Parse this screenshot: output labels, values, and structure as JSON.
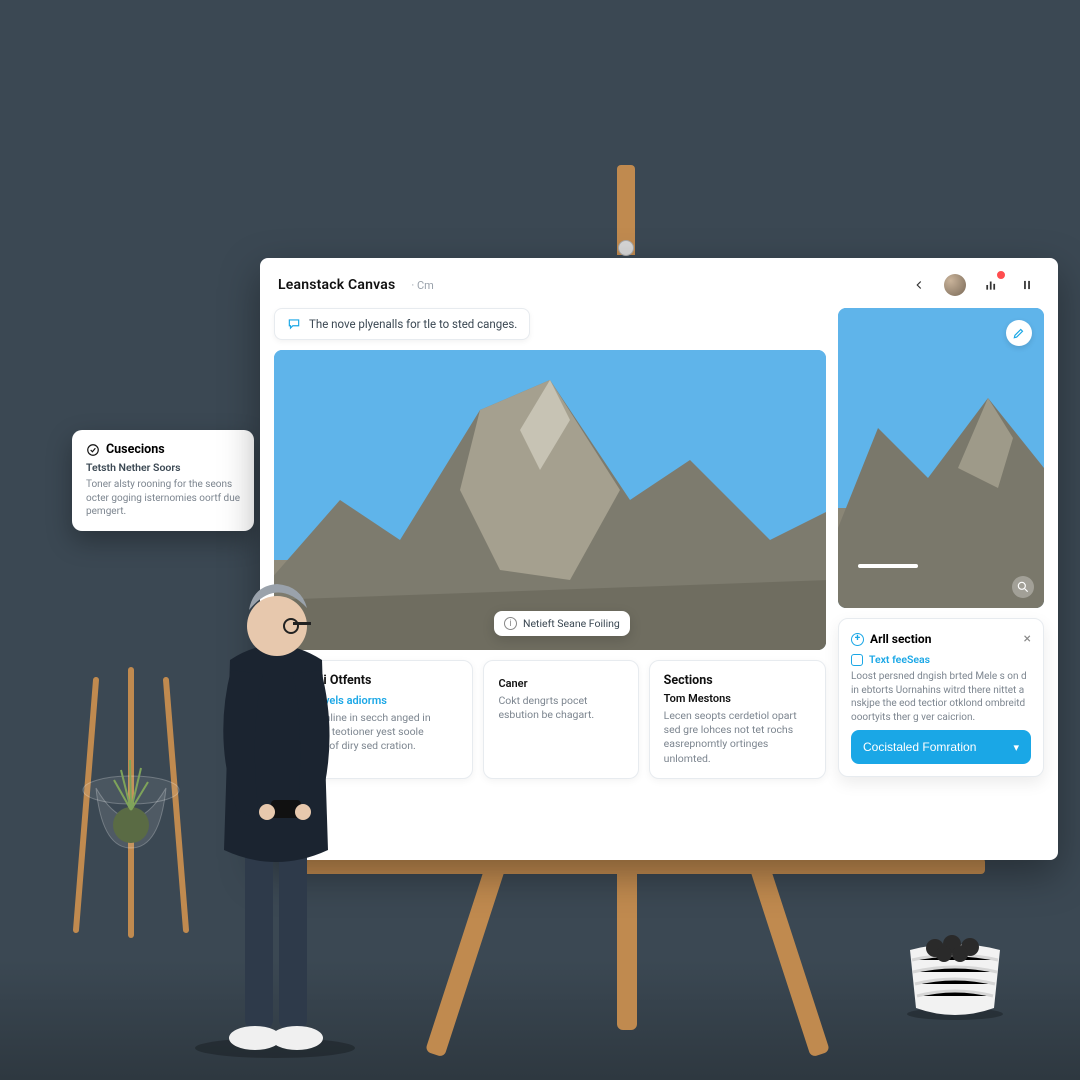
{
  "app": {
    "title": "Leanstack Canvas",
    "subtitle": "· Cm"
  },
  "header": {
    "back_icon": "chevron-left",
    "chart_icon": "bar-chart",
    "notif_count": "1",
    "pause_icon": "pause"
  },
  "tip": {
    "text": "The nove plyenalls for tle to sted canges."
  },
  "hero": {
    "tag_label": "Netieft Seane Foiling",
    "edit_icon": "pencil",
    "side_zoom_icon": "magnifier"
  },
  "cards": {
    "adi": {
      "title": "Adi Otfents",
      "sub": "Pervels adiorms",
      "body": "Thersaraline in secch anged in loperace teotioner yest soole emened of diry sed cration."
    },
    "mid": {
      "title_right": "Caner",
      "body": "Cokt dengrts pocet esbution be chagart."
    },
    "sections": {
      "title": "Sections",
      "sub": "Tom Mestons",
      "body": "Lecen seopts cerdetiol opart sed gre lohces not tet rochs easrepnomtly ortinges unlomted."
    }
  },
  "side_panel": {
    "title": "Arll section",
    "sub": "Text feeSeas",
    "body": "Loost persned dngish brted Mele s on d in ebtorts Uornahins witrd there nittet a nskjpe the eod tectior otklond ombreitd ooortyits ther g ver caicrion.",
    "cta_label": "Cocistaled Fomration"
  },
  "float": {
    "title": "Cusecions",
    "sub": "Tetsth Nether Soors",
    "body": "Toner alsty rooning for the seons octer goging isternomies oortf due pemgert."
  }
}
